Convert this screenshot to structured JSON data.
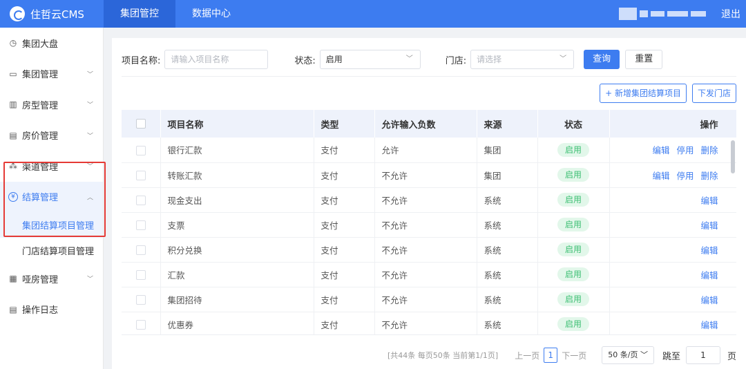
{
  "brand": {
    "name": "住哲云CMS",
    "icon": "brand-logo-icon"
  },
  "topnav": [
    {
      "label": "集团管控",
      "active": true
    },
    {
      "label": "数据中心",
      "active": false
    }
  ],
  "header": {
    "logout_label": "退出"
  },
  "sidebar": {
    "items": [
      {
        "label": "集团大盘",
        "icon": "clock-icon",
        "glyph": "◷",
        "expandable": false
      },
      {
        "label": "集团管理",
        "icon": "monitor-icon",
        "glyph": "▭",
        "expandable": true
      },
      {
        "label": "房型管理",
        "icon": "building-icon",
        "glyph": "▥",
        "expandable": true
      },
      {
        "label": "房价管理",
        "icon": "card-icon",
        "glyph": "▤",
        "expandable": true
      },
      {
        "label": "渠道管理",
        "icon": "network-icon",
        "glyph": "⁂",
        "expandable": true
      },
      {
        "label": "结算管理",
        "icon": "yen-icon",
        "glyph": "¥",
        "expandable": true,
        "expanded": true,
        "children": [
          {
            "label": "集团结算项目管理",
            "active": true
          },
          {
            "label": "门店结算项目管理",
            "active": false
          }
        ]
      },
      {
        "label": "哑房管理",
        "icon": "document-edit-icon",
        "glyph": "▦",
        "expandable": true
      },
      {
        "label": "操作日志",
        "icon": "log-icon",
        "glyph": "▤",
        "expandable": false
      }
    ]
  },
  "filters": {
    "name_label": "项目名称:",
    "name_placeholder": "请输入项目名称",
    "status_label": "状态:",
    "status_value": "启用",
    "store_label": "门店:",
    "store_placeholder": "请选择",
    "search_label": "查询",
    "reset_label": "重置"
  },
  "actions": {
    "add_label": "+ 新增集团结算项目",
    "dispatch_label": "下发门店"
  },
  "table": {
    "columns": [
      "项目名称",
      "类型",
      "允许输入负数",
      "来源",
      "状态",
      "操作"
    ],
    "rows": [
      {
        "name": "银行汇款",
        "type": "支付",
        "negative": "允许",
        "source": "集团",
        "status": "启用",
        "ops": [
          "编辑",
          "停用",
          "删除"
        ]
      },
      {
        "name": "转账汇款",
        "type": "支付",
        "negative": "不允许",
        "source": "集团",
        "status": "启用",
        "ops": [
          "编辑",
          "停用",
          "删除"
        ]
      },
      {
        "name": "现金支出",
        "type": "支付",
        "negative": "不允许",
        "source": "系统",
        "status": "启用",
        "ops": [
          "编辑"
        ]
      },
      {
        "name": "支票",
        "type": "支付",
        "negative": "不允许",
        "source": "系统",
        "status": "启用",
        "ops": [
          "编辑"
        ]
      },
      {
        "name": "积分兑换",
        "type": "支付",
        "negative": "不允许",
        "source": "系统",
        "status": "启用",
        "ops": [
          "编辑"
        ]
      },
      {
        "name": "汇款",
        "type": "支付",
        "negative": "不允许",
        "source": "系统",
        "status": "启用",
        "ops": [
          "编辑"
        ]
      },
      {
        "name": "集团招待",
        "type": "支付",
        "negative": "不允许",
        "source": "系统",
        "status": "启用",
        "ops": [
          "编辑"
        ]
      },
      {
        "name": "优惠券",
        "type": "支付",
        "negative": "不允许",
        "source": "系统",
        "status": "启用",
        "ops": [
          "编辑"
        ]
      }
    ]
  },
  "pagination": {
    "summary": "[共44条 每页50条 当前第1/1页]",
    "prev_label": "上一页",
    "current_page": "1",
    "next_label": "下一页",
    "per_page": "50 条/页",
    "jump_label": "跳至",
    "jump_value": "1",
    "jump_suffix": "页"
  },
  "colors": {
    "primary": "#3d7cf0",
    "status_green": "#3cbf72",
    "highlight_border": "#e53935"
  }
}
